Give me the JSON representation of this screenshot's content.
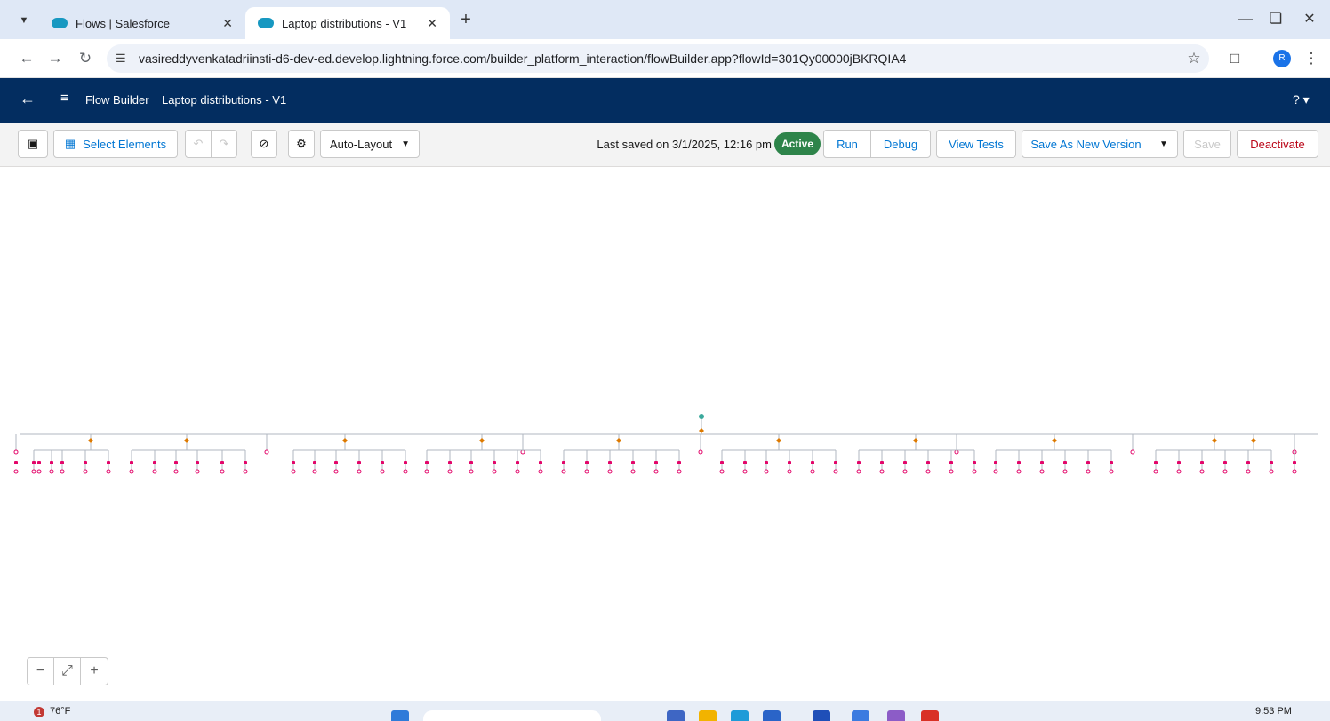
{
  "browser": {
    "tabs": [
      {
        "title": "Flows | Salesforce",
        "active": false
      },
      {
        "title": "Laptop distributions - V1",
        "active": true
      }
    ],
    "url": "vasireddyvenkatadriinsti-d6-dev-ed.develop.lightning.force.com/builder_platform_interaction/flowBuilder.app?flowId=301Qy00000jBKRQIA4",
    "profile_initial": "R"
  },
  "header": {
    "app_name": "Flow Builder",
    "flow_name": "Laptop distributions - V1",
    "help": "?"
  },
  "toolbar": {
    "select_elements": "Select Elements",
    "layout_mode": "Auto-Layout",
    "last_saved": "Last saved on 3/1/2025, 12:16 pm",
    "status": "Active",
    "run": "Run",
    "debug": "Debug",
    "view_tests": "View Tests",
    "save_as_new_version": "Save As New Version",
    "save": "Save",
    "deactivate": "Deactivate"
  },
  "canvas": {
    "decision_branch_groups": 10,
    "colors": {
      "start": "#3ba99c",
      "decision": "#dd7a01",
      "action": "#e3066a",
      "connector": "#b0b7c0"
    }
  },
  "taskbar": {
    "weather": "76°F",
    "notification_count": "1",
    "clock": "9:53 PM"
  },
  "colors": {
    "sf_header": "#032d60",
    "brand_blue": "#0176d3",
    "active_badge": "#2e844a",
    "deactivate": "#ba0517"
  }
}
